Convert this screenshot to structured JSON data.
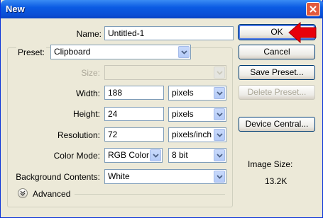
{
  "window": {
    "title": "New"
  },
  "name_field": {
    "label": "Name:",
    "value": "Untitled-1"
  },
  "preset": {
    "label": "Preset:",
    "value": "Clipboard"
  },
  "size": {
    "label": "Size:",
    "value": ""
  },
  "width": {
    "label": "Width:",
    "value": "188",
    "unit": "pixels"
  },
  "height": {
    "label": "Height:",
    "value": "24",
    "unit": "pixels"
  },
  "resolution": {
    "label": "Resolution:",
    "value": "72",
    "unit": "pixels/inch"
  },
  "color_mode": {
    "label": "Color Mode:",
    "value": "RGB Color",
    "depth": "8 bit"
  },
  "background": {
    "label": "Background Contents:",
    "value": "White"
  },
  "advanced": {
    "label": "Advanced"
  },
  "buttons": {
    "ok": "OK",
    "cancel": "Cancel",
    "save_preset": "Save Preset...",
    "delete_preset": "Delete Preset...",
    "device_central": "Device Central..."
  },
  "image_size": {
    "label": "Image Size:",
    "value": "13.2K"
  },
  "colors": {
    "titlebar": "#0a4fd6",
    "dialog_bg": "#ece9d8",
    "arrow_annotation": "#e8000b"
  }
}
